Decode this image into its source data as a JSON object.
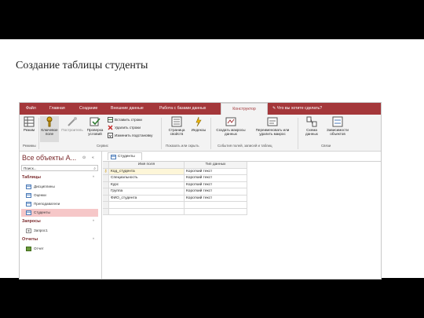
{
  "slide": {
    "title": "Создание таблицы студенты"
  },
  "ribbon_tabs": [
    "Файл",
    "Главная",
    "Создание",
    "Внешние данные",
    "Работа с базами данных",
    "Конструктор"
  ],
  "tell_me": "Что вы хотите сделать?",
  "ribbon": {
    "view_label": "Режим",
    "key_label": "Ключевое поле",
    "builder_label": "Построитель",
    "test_label": "Проверка условий",
    "insert_rows": "Вставить строки",
    "delete_rows": "Удалить строки",
    "change_lookup": "Изменить подстановку",
    "property_sheet": "Страница свойств",
    "indexes": "Индексы",
    "create_macros": "Создать макросы данных",
    "rename_macro": "Переименовать или удалить макрос",
    "schema": "Схема данных",
    "dependencies": "Зависимости объектов",
    "groups": [
      "Режимы",
      "Сервис",
      "Показать или скрыть",
      "События полей, записей и таблиц",
      "Связи"
    ]
  },
  "nav": {
    "header": "Все объекты A...",
    "search_placeholder": "Поиск...",
    "sections": [
      {
        "title": "Таблицы",
        "items": [
          "Дисциплины",
          "Оценки",
          "Преподаватели",
          "Студенты"
        ]
      },
      {
        "title": "Запросы",
        "items": [
          "Запрос1"
        ]
      },
      {
        "title": "Отчеты",
        "items": [
          "Отчет"
        ]
      }
    ],
    "selected_item": "Студенты"
  },
  "document_tab": "Студенты",
  "design_grid": {
    "headers": [
      "Имя поля",
      "Тип данных"
    ],
    "rows": [
      {
        "field": "Код_студента",
        "type": "Короткий текст",
        "key": true
      },
      {
        "field": "Специальность",
        "type": "Короткий текст"
      },
      {
        "field": "Курс",
        "type": "Короткий текст"
      },
      {
        "field": "Группа",
        "type": "Короткий текст"
      },
      {
        "field": "ФИО_студента",
        "type": "Короткий текст"
      }
    ]
  },
  "colors": {
    "accent": "#a4373a",
    "selected": "#f6c7c8"
  }
}
